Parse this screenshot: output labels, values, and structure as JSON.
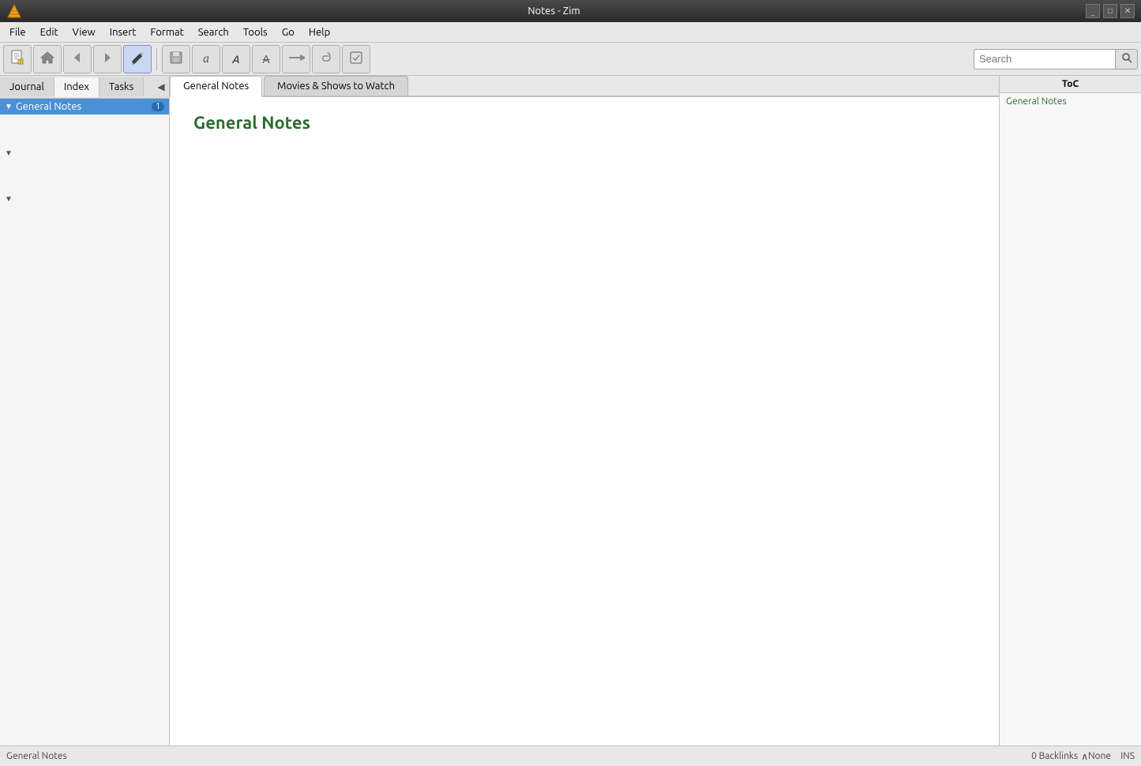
{
  "titlebar": {
    "title": "Notes - Zim",
    "minimize_label": "_",
    "maximize_label": "□",
    "close_label": "✕"
  },
  "menubar": {
    "items": [
      {
        "id": "file",
        "label": "File"
      },
      {
        "id": "edit",
        "label": "Edit"
      },
      {
        "id": "view",
        "label": "View"
      },
      {
        "id": "insert",
        "label": "Insert"
      },
      {
        "id": "format",
        "label": "Format"
      },
      {
        "id": "search",
        "label": "Search"
      },
      {
        "id": "tools",
        "label": "Tools"
      },
      {
        "id": "go",
        "label": "Go"
      },
      {
        "id": "help",
        "label": "Help"
      }
    ]
  },
  "toolbar": {
    "buttons": [
      {
        "id": "new-page",
        "icon": "📄",
        "tooltip": "New Page"
      },
      {
        "id": "home",
        "icon": "🏠",
        "tooltip": "Home"
      },
      {
        "id": "back",
        "icon": "◀",
        "tooltip": "Back"
      },
      {
        "id": "forward",
        "icon": "▶",
        "tooltip": "Forward"
      },
      {
        "id": "edit-mode",
        "icon": "✏️",
        "tooltip": "Edit Mode",
        "active": true
      },
      {
        "id": "save",
        "icon": "💾",
        "tooltip": "Save"
      },
      {
        "id": "italic",
        "icon": "𝘐",
        "tooltip": "Italic"
      },
      {
        "id": "bold",
        "icon": "𝗕",
        "tooltip": "Bold"
      },
      {
        "id": "strikethrough",
        "icon": "S̶",
        "tooltip": "Strikethrough"
      },
      {
        "id": "bookmark",
        "icon": "⇒",
        "tooltip": "Bookmark"
      },
      {
        "id": "attach",
        "icon": "📎",
        "tooltip": "Attach File"
      },
      {
        "id": "checklist",
        "icon": "☑",
        "tooltip": "Checklist"
      }
    ],
    "search_placeholder": "Search"
  },
  "sidebar": {
    "tabs": [
      {
        "id": "journal",
        "label": "Journal"
      },
      {
        "id": "index",
        "label": "Index",
        "active": true
      },
      {
        "id": "tasks",
        "label": "Tasks"
      }
    ],
    "collapse_icon": "◀",
    "tree": [
      {
        "id": "general-notes",
        "label": "General Notes",
        "badge": "1",
        "expanded": true,
        "selected": true,
        "arrow": "▼"
      },
      {
        "id": "item2",
        "label": "",
        "arrow": "▼",
        "indent": 0
      },
      {
        "id": "item3",
        "label": "",
        "arrow": "▼",
        "indent": 0
      }
    ]
  },
  "content": {
    "tabs": [
      {
        "id": "general-notes",
        "label": "General Notes",
        "active": true
      },
      {
        "id": "movies-shows",
        "label": "Movies & Shows to Watch",
        "active": false
      }
    ],
    "page_title": "General Notes"
  },
  "toc": {
    "header": "ToC",
    "items": [
      {
        "id": "general-notes-link",
        "label": "General Notes"
      }
    ]
  },
  "statusbar": {
    "page_name": "General Notes",
    "backlinks": "0 Backlinks",
    "backlinks_icon": "∧",
    "mode": "None",
    "insert": "INS"
  }
}
